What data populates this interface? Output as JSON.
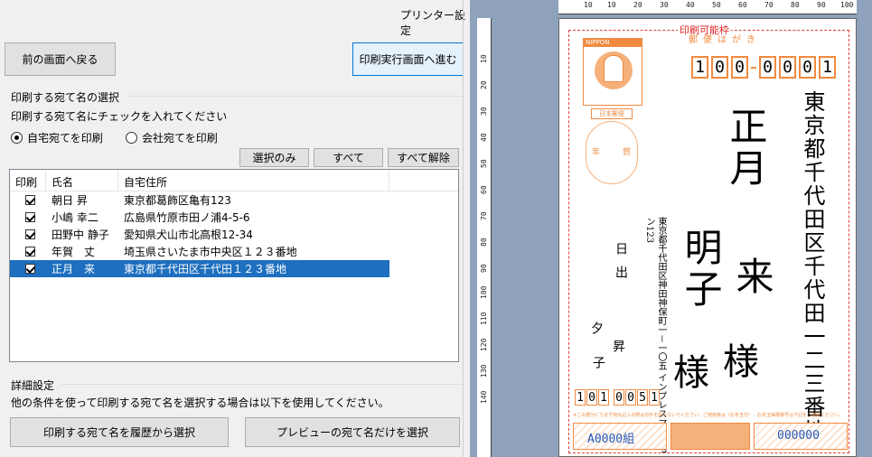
{
  "header": {
    "printer_settings_label": "プリンター設定"
  },
  "nav": {
    "back_label": "前の画面へ戻る",
    "next_label": "印刷実行画面へ進む"
  },
  "selection": {
    "group_title": "印刷する宛て名の選択",
    "instruction": "印刷する宛て名にチェックを入れてください",
    "radio_home": "自宅宛てを印刷",
    "radio_company": "会社宛てを印刷",
    "radio_selected": "home",
    "btn_selected_only": "選択のみ",
    "btn_all": "すべて",
    "btn_clear_all": "すべて解除"
  },
  "list": {
    "headers": {
      "print": "印刷",
      "name": "氏名",
      "address": "自宅住所"
    },
    "rows": [
      {
        "checked": true,
        "name": "朝日 昇",
        "address": "東京都葛飾区亀有123",
        "selected": false
      },
      {
        "checked": true,
        "name": "小嶋 幸二",
        "address": "広島県竹原市田ノ浦4-5-6",
        "selected": false
      },
      {
        "checked": true,
        "name": "田野中 静子",
        "address": "愛知県犬山市北高根12-34",
        "selected": false
      },
      {
        "checked": true,
        "name": "年賀　丈",
        "address": "埼玉県さいたま市中央区１２３番地",
        "selected": false
      },
      {
        "checked": true,
        "name": "正月　来",
        "address": "東京都千代田区千代田１２３番地",
        "selected": true
      }
    ]
  },
  "detail": {
    "group_title": "詳細設定",
    "note": "他の条件を使って印刷する宛て名を選択する場合は以下を使用してください。",
    "btn_history": "印刷する宛て名を履歴から選択",
    "btn_preview": "プレビューの宛て名だけを選択"
  },
  "preview": {
    "printable_label": "印刷可能枠",
    "ruler_top": [
      "10",
      "10",
      "20",
      "30",
      "40",
      "50",
      "60",
      "70",
      "80",
      "90",
      "100"
    ],
    "ruler_left": [
      "10",
      "20",
      "30",
      "40",
      "50",
      "60",
      "70",
      "80",
      "90",
      "100",
      "110",
      "120",
      "130",
      "140"
    ],
    "stamp_top": "NIPPON",
    "stamp_bottom": "日本郵便",
    "stamp_sub": "日本郵便",
    "postmark_year": "年",
    "postmark_pref": "賀",
    "nenga_label": "郵便はがき",
    "recipient_zip": [
      "1",
      "0",
      "0",
      "0",
      "0",
      "0",
      "1"
    ],
    "recipient_address": "東京都千代田区千代田一二三番地",
    "recipient_name_line1": "正月",
    "recipient_name_line1b": "来",
    "recipient_name_line2": "明子",
    "honorific": "様",
    "honorific2": "様",
    "sender_address": "東京都千代田区神田神保町一－一〇五 インプレスマンション123",
    "sender_name1": "日出",
    "sender_name2": "夕",
    "sender_name3": "昇",
    "sender_name4": "子",
    "sender_zip": [
      "1",
      "0",
      "1",
      "0",
      "0",
      "5",
      "1"
    ],
    "lottery_text": "※この部分にて必ず宛先記入の際は切手を貼らないでください。ご使用後は（お年玉付）…お年玉抽選番号は下記をご確認ください。",
    "lottery_left": "A0000組",
    "lottery_right": "000000"
  },
  "colors": {
    "accent": "#f08a40",
    "selection": "#1e6fbf",
    "preview_bg": "#8ea2bb"
  }
}
